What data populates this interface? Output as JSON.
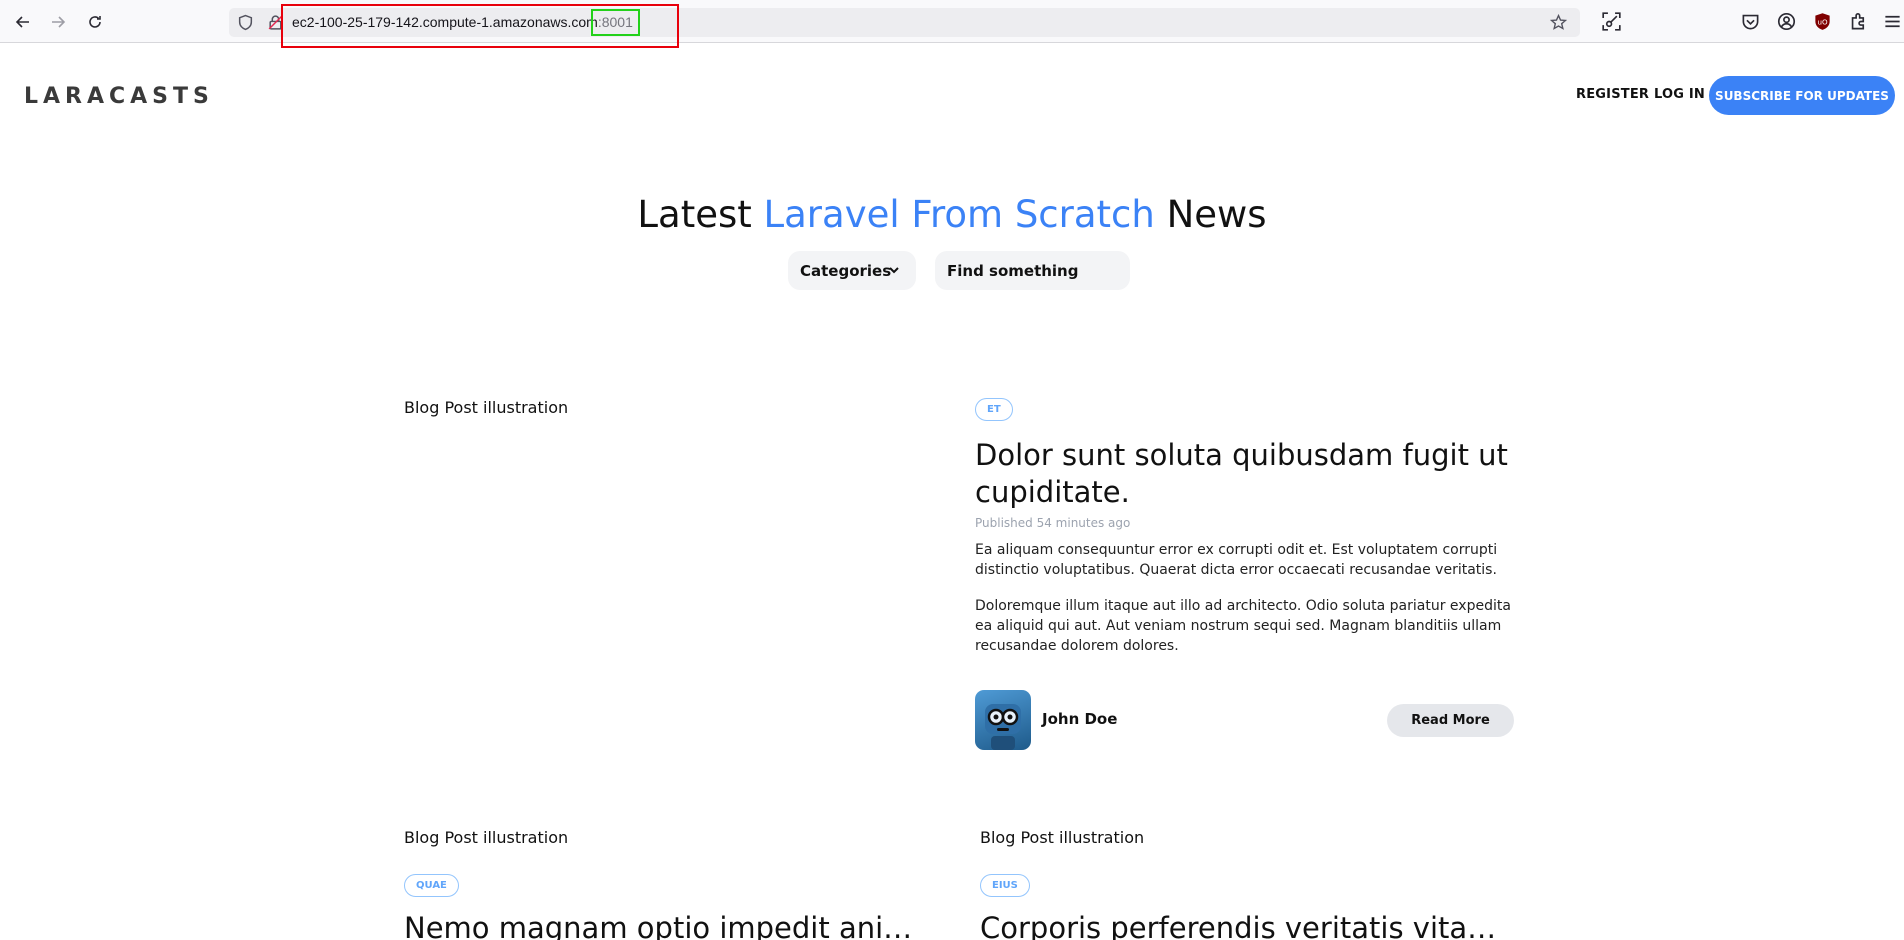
{
  "browser": {
    "url_host": "ec2-100-25-179-142.compute-1.amazonaws.com",
    "url_port": ":8001",
    "icons": [
      "back-arrow-icon",
      "forward-arrow-icon",
      "reload-icon",
      "shield-icon",
      "insecure-lock-icon",
      "bookmark-star-icon",
      "screenshot-icon",
      "pocket-icon",
      "account-icon",
      "ublock-icon",
      "extensions-icon",
      "menu-icon"
    ],
    "highlight_colors": {
      "outer": "#e8000b",
      "inner": "#23d11a"
    }
  },
  "header": {
    "logo": "LARACASTS",
    "register": "Register",
    "login": "Log In",
    "subscribe": "Subscribe for Updates"
  },
  "hero": {
    "title_before": "Latest ",
    "title_accent": "Laravel From Scratch",
    "title_after": " News",
    "accent_color": "#3b82f6",
    "categories_label": "Categories",
    "search_placeholder": "Find something"
  },
  "featured": {
    "illustration_label": "Blog Post illustration",
    "tag": "ET",
    "title": "Dolor sunt soluta quibusdam fugit ut cupiditate.",
    "published": "Published 54 minutes ago",
    "excerpt_1": "Ea aliquam consequuntur error ex corrupti odit et. Est voluptatem corrupti distinctio voluptatibus. Quaerat dicta error occaecati recusandae veritatis.",
    "excerpt_2": "Doloremque illum itaque aut illo ad architecto. Odio soluta pariatur expedita ea aliquid qui aut. Aut veniam nostrum sequi sed. Magnam blanditiis ullam recusandae dolorem dolores.",
    "author": "John Doe",
    "read_more": "Read More"
  },
  "posts": [
    {
      "illustration_label": "Blog Post illustration",
      "tag": "QUAE",
      "title": "Nemo magnam optio impedit animi..."
    },
    {
      "illustration_label": "Blog Post illustration",
      "tag": "EIUS",
      "title": "Corporis perferendis veritatis vitae..."
    }
  ]
}
